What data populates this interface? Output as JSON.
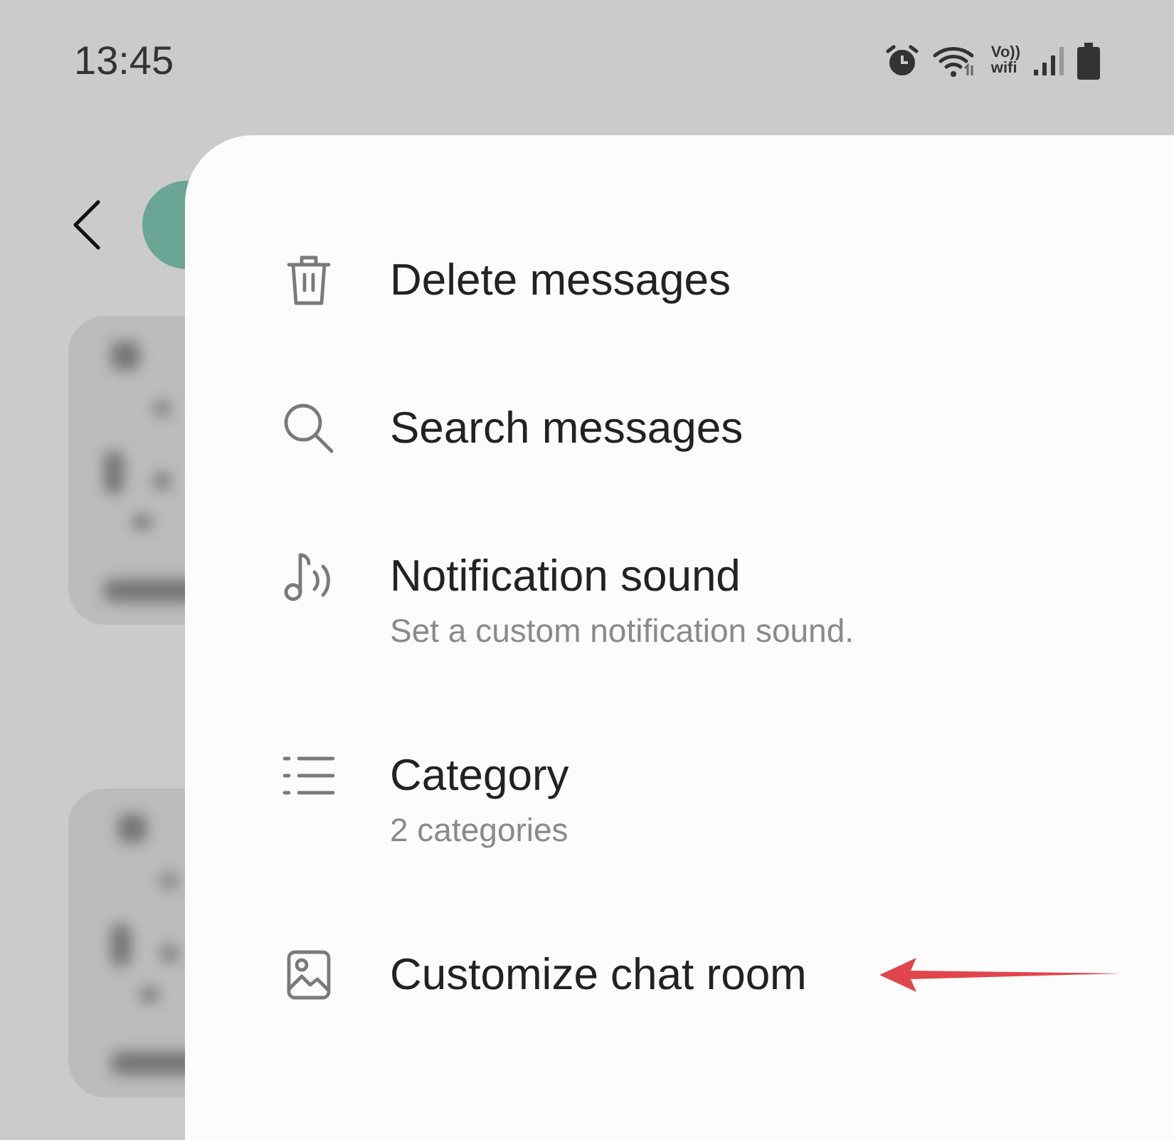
{
  "status_bar": {
    "time": "13:45",
    "network_label": [
      "Vo))",
      "wifi"
    ]
  },
  "menu": {
    "items": [
      {
        "title": "Delete messages",
        "annotated": false
      },
      {
        "title": "Search messages",
        "annotated": false
      },
      {
        "title": "Notification sound",
        "subtitle": "Set a custom notification sound.",
        "annotated": false
      },
      {
        "title": "Category",
        "subtitle": "2 categories",
        "annotated": false
      },
      {
        "title": "Customize chat room",
        "annotated": true
      }
    ]
  }
}
